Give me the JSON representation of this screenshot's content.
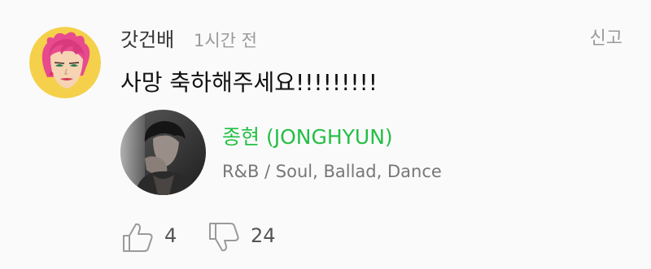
{
  "comment": {
    "username": "갓건배",
    "time": "1시간 전",
    "report_label": "신고",
    "text": "사망 축하해주세요!!!!!!!!!"
  },
  "artist": {
    "name": "종현 (JONGHYUN)",
    "genre": "R&B / Soul, Ballad, Dance"
  },
  "reactions": {
    "likes": "4",
    "dislikes": "24"
  },
  "colors": {
    "artist_name": "#23bf45",
    "muted_text": "#9a9a9a",
    "background": "#fafafa"
  },
  "icons": {
    "like": "thumbs-up-icon",
    "dislike": "thumbs-down-icon"
  }
}
